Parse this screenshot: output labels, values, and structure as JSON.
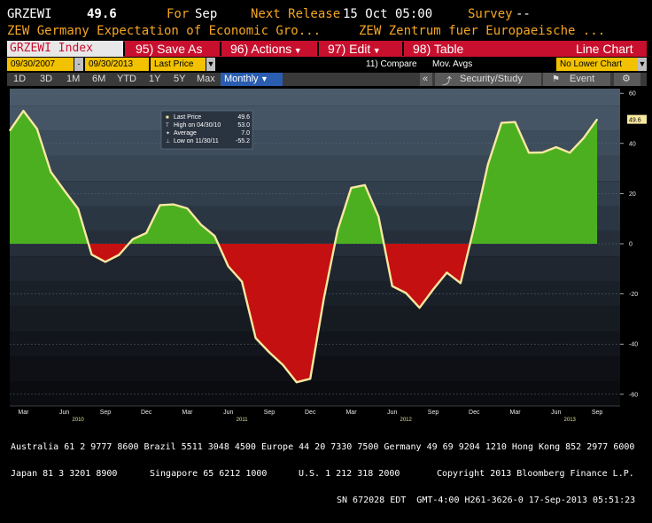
{
  "header": {
    "ticker": "GRZEWI",
    "last_value": "49.6",
    "for_label": "For",
    "for_period": "Sep",
    "next_release_label": "Next Release",
    "next_release_date": "15 Oct 05:00",
    "survey_label": "Survey",
    "survey_value": "--",
    "desc_left": "ZEW Germany Expectation of Economic Gro...",
    "desc_right": "ZEW Zentrum fuer Europaeische ..."
  },
  "toolbar": {
    "index_label": "GRZEWI Index",
    "save_as": "95) Save As",
    "actions": "96) Actions",
    "edit": "97) Edit",
    "table": "98) Table",
    "line_chart": "Line Chart",
    "start_date": "09/30/2007",
    "end_date": "09/30/2013",
    "price_field": "Last Price",
    "compare": "11) Compare",
    "mov_avgs": "Mov. Avgs",
    "lower_chart": "No Lower Chart",
    "ranges": [
      "1D",
      "3D",
      "1M",
      "6M",
      "YTD",
      "1Y",
      "5Y",
      "Max"
    ],
    "period": "Monthly",
    "security_study": "Security/Study",
    "event": "Event"
  },
  "colors": {
    "positive_fill": "#4caf20",
    "negative_fill": "#c41010",
    "line": "#f7e8a0",
    "label_bg": "#f7e8a0",
    "toolbar_red": "#c8102e",
    "accent_orange": "#f5a623"
  },
  "chart_data": {
    "type": "area",
    "series": [
      {
        "name": "Last Price",
        "x": [
          "2010-02",
          "2010-03",
          "2010-04",
          "2010-05",
          "2010-06",
          "2010-07",
          "2010-08",
          "2010-09",
          "2010-10",
          "2010-11",
          "2010-12",
          "2011-01",
          "2011-02",
          "2011-03",
          "2011-04",
          "2011-05",
          "2011-06",
          "2011-07",
          "2011-08",
          "2011-09",
          "2011-10",
          "2011-11",
          "2011-12",
          "2012-01",
          "2012-02",
          "2012-03",
          "2012-04",
          "2012-05",
          "2012-06",
          "2012-07",
          "2012-08",
          "2012-09",
          "2012-10",
          "2012-11",
          "2012-12",
          "2013-01",
          "2013-02",
          "2013-03",
          "2013-04",
          "2013-05",
          "2013-06",
          "2013-07",
          "2013-08",
          "2013-09"
        ],
        "values": [
          45.1,
          53.0,
          45.8,
          28.7,
          21.2,
          14.0,
          -4.3,
          -7.2,
          -4.4,
          1.8,
          4.3,
          15.4,
          15.7,
          14.1,
          7.6,
          3.1,
          -9.0,
          -15.1,
          -37.6,
          -43.3,
          -48.3,
          -55.2,
          -53.8,
          -21.6,
          5.4,
          22.3,
          23.4,
          10.8,
          -16.9,
          -19.6,
          -25.5,
          -18.2,
          -11.5,
          -15.7,
          6.9,
          31.5,
          48.2,
          48.5,
          36.3,
          36.4,
          38.5,
          36.3,
          42.0,
          49.6
        ]
      }
    ],
    "ylim": [
      -60,
      65
    ],
    "yticks": [
      "60",
      "40",
      "20",
      "0",
      "-20",
      "-40",
      "-60"
    ],
    "xticks": [
      "Mar",
      "Jun",
      "Sep",
      "Dec",
      "Mar",
      "Jun",
      "Sep",
      "Dec",
      "Mar",
      "Jun",
      "Sep",
      "Dec",
      "Mar",
      "Jun",
      "Sep"
    ],
    "year_labels": [
      "2010",
      "2011",
      "2012",
      "2013"
    ],
    "last_value_label": "49.6",
    "legend": {
      "rows": [
        {
          "label": "Last Price",
          "value": "49.6"
        },
        {
          "label": "High on 04/30/10",
          "value": "53.0"
        },
        {
          "label": "Average",
          "value": "7.0"
        },
        {
          "label": "Low on 11/30/11",
          "value": "-55.2"
        }
      ],
      "placement": "top-left"
    },
    "grid": true
  },
  "footer": {
    "line1": "Australia 61 2 9777 8600 Brazil 5511 3048 4500 Europe 44 20 7330 7500 Germany 49 69 9204 1210 Hong Kong 852 2977 6000",
    "line2_left": "Japan 81 3 3201 8900",
    "line2_mid1": "Singapore 65 6212 1000",
    "line2_mid2": "U.S. 1 212 318 2000",
    "line2_right": "Copyright 2013 Bloomberg Finance L.P.",
    "line3": "SN 672028 EDT  GMT-4:00 H261-3626-0 17-Sep-2013 05:51:23"
  }
}
